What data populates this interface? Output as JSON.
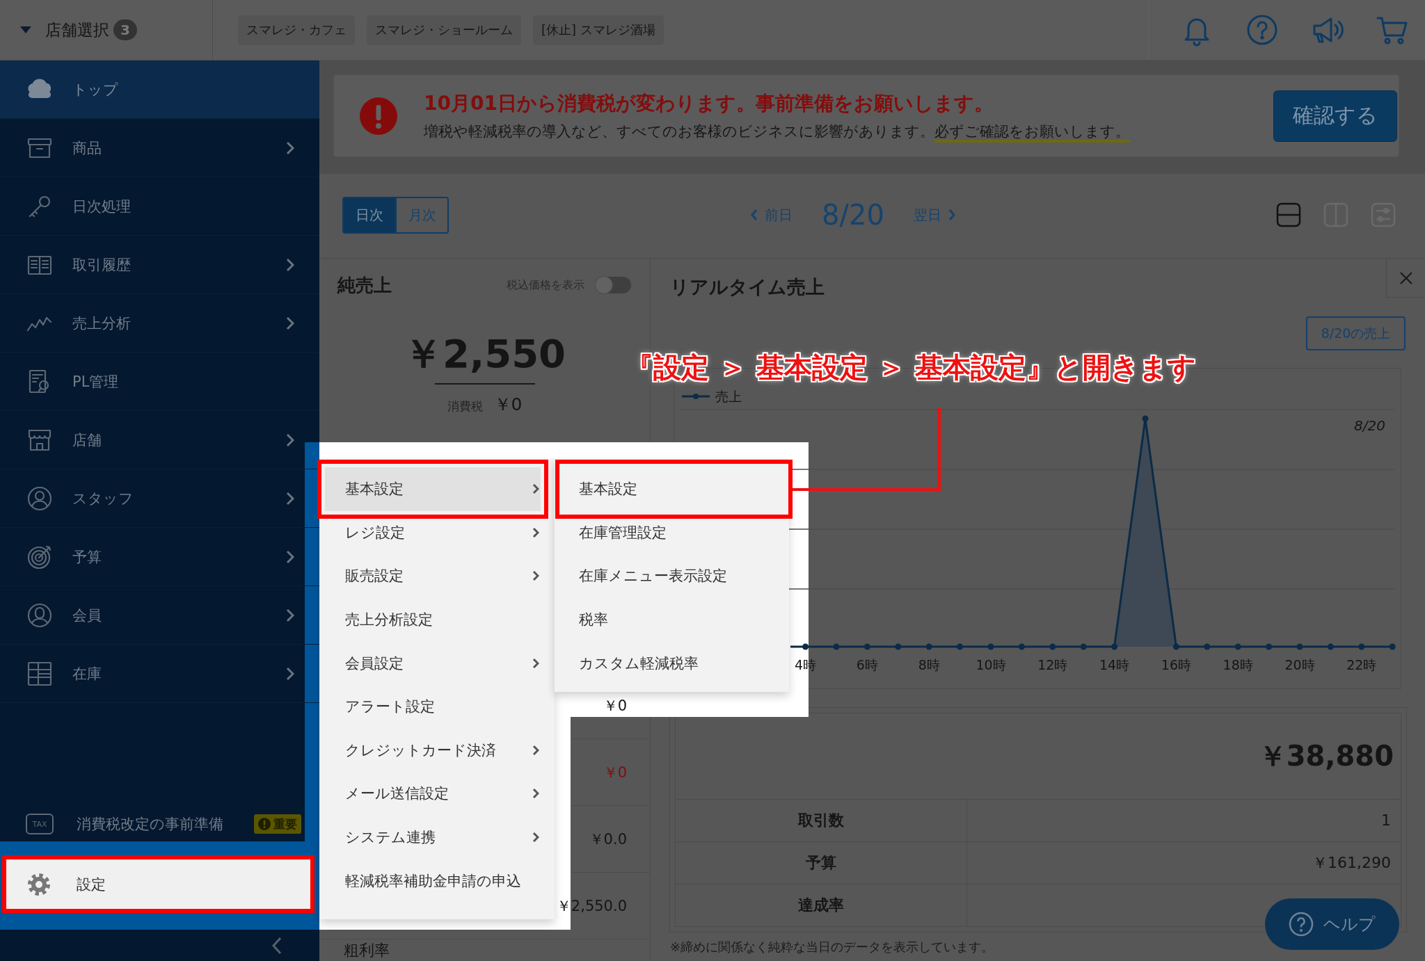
{
  "header": {
    "store_select": {
      "label": "店舗選択",
      "count": "3"
    },
    "stores": [
      {
        "label": "スマレジ・カフェ"
      },
      {
        "label": "スマレジ・ショールーム"
      },
      {
        "label": "[休止] スマレジ酒場"
      }
    ]
  },
  "sidebar": {
    "items": [
      {
        "label": "トップ",
        "selected": true,
        "has_submenu": false
      },
      {
        "label": "商品",
        "selected": false,
        "has_submenu": true
      },
      {
        "label": "日次処理",
        "selected": false,
        "has_submenu": false
      },
      {
        "label": "取引履歴",
        "selected": false,
        "has_submenu": true
      },
      {
        "label": "売上分析",
        "selected": false,
        "has_submenu": true
      },
      {
        "label": "PL管理",
        "selected": false,
        "has_submenu": false
      },
      {
        "label": "店舗",
        "selected": false,
        "has_submenu": true
      },
      {
        "label": "スタッフ",
        "selected": false,
        "has_submenu": true
      },
      {
        "label": "予算",
        "selected": false,
        "has_submenu": true
      },
      {
        "label": "会員",
        "selected": false,
        "has_submenu": true
      },
      {
        "label": "在庫",
        "selected": false,
        "has_submenu": true
      }
    ],
    "notice": {
      "icon_text": "TAX",
      "label": "消費税改定の事前準備",
      "badge": "重要"
    },
    "settings": {
      "label": "設定",
      "highlighted": true
    }
  },
  "banner": {
    "title": "10月01日から消費税が変わります。事前準備をお願いします。",
    "text": "増税や軽減税率の導入など、すべてのお客様のビジネスに影響があります。",
    "highlight": "必ずご確認をお願いします。",
    "button": "確認する"
  },
  "toolbar": {
    "period_tabs": [
      {
        "label": "日次",
        "selected": true
      },
      {
        "label": "月次",
        "selected": false
      }
    ],
    "prev": "前日",
    "date": "8/20",
    "next": "翌日",
    "layout_options": [
      {
        "selected": true
      },
      {
        "selected": false
      },
      {
        "selected": false
      }
    ]
  },
  "net_sales": {
    "title": "純売上",
    "tax_toggle": {
      "label": "税込価格を表示",
      "on": false
    },
    "total": "￥2,550",
    "tax_label": "消費税",
    "tax_value": "￥0",
    "rows": [
      {
        "value": "￥0",
        "alert": false
      },
      {
        "value": "￥0",
        "alert": true
      },
      {
        "value": "￥0.0",
        "alert": false
      },
      {
        "value": "￥2,550.0",
        "alert": false
      },
      {
        "label": "粗利率"
      }
    ]
  },
  "realtime_sales": {
    "title": "リアルタイム売上",
    "date_button": "8/20の売上",
    "chart": {
      "legend": "売上",
      "date_label": "8/20",
      "x_labels": [
        "4時",
        "6時",
        "8時",
        "10時",
        "12時",
        "14時",
        "16時",
        "18時",
        "20時",
        "22時"
      ]
    },
    "summary": {
      "total": "￥38,880",
      "rows": [
        {
          "label": "取引数",
          "value": "1"
        },
        {
          "label": "予算",
          "value": "￥161,290"
        },
        {
          "label": "達成率"
        }
      ]
    },
    "note": "※締めに関係なく純粋な当日のデータを表示しています。"
  },
  "help_button": "ヘルプ",
  "settings_menu": {
    "items": [
      {
        "label": "基本設定",
        "has_submenu": true,
        "selected": true,
        "highlighted": true,
        "children": [
          {
            "label": "基本設定",
            "selected": false,
            "highlighted": true
          },
          {
            "label": "在庫管理設定",
            "selected": false,
            "highlighted": false
          },
          {
            "label": "在庫メニュー表示設定",
            "selected": false,
            "highlighted": false
          },
          {
            "label": "税率",
            "selected": false,
            "highlighted": false
          },
          {
            "label": "カスタム軽減税率",
            "selected": false,
            "highlighted": false
          }
        ]
      },
      {
        "label": "レジ設定",
        "has_submenu": true,
        "selected": false,
        "highlighted": false
      },
      {
        "label": "販売設定",
        "has_submenu": true,
        "selected": false,
        "highlighted": false
      },
      {
        "label": "売上分析設定",
        "has_submenu": false,
        "selected": false,
        "highlighted": false
      },
      {
        "label": "会員設定",
        "has_submenu": true,
        "selected": false,
        "highlighted": false
      },
      {
        "label": "アラート設定",
        "has_submenu": false,
        "selected": false,
        "highlighted": false
      },
      {
        "label": "クレジットカード決済",
        "has_submenu": true,
        "selected": false,
        "highlighted": false
      },
      {
        "label": "メール送信設定",
        "has_submenu": true,
        "selected": false,
        "highlighted": false
      },
      {
        "label": "システム連携",
        "has_submenu": true,
        "selected": false,
        "highlighted": false
      },
      {
        "label": "軽減税率補助金申請の申込",
        "has_submenu": false,
        "selected": false,
        "highlighted": false
      }
    ]
  },
  "annotation": {
    "text": "『設定 ＞ 基本設定 ＞ 基本設定』と開きます"
  }
}
